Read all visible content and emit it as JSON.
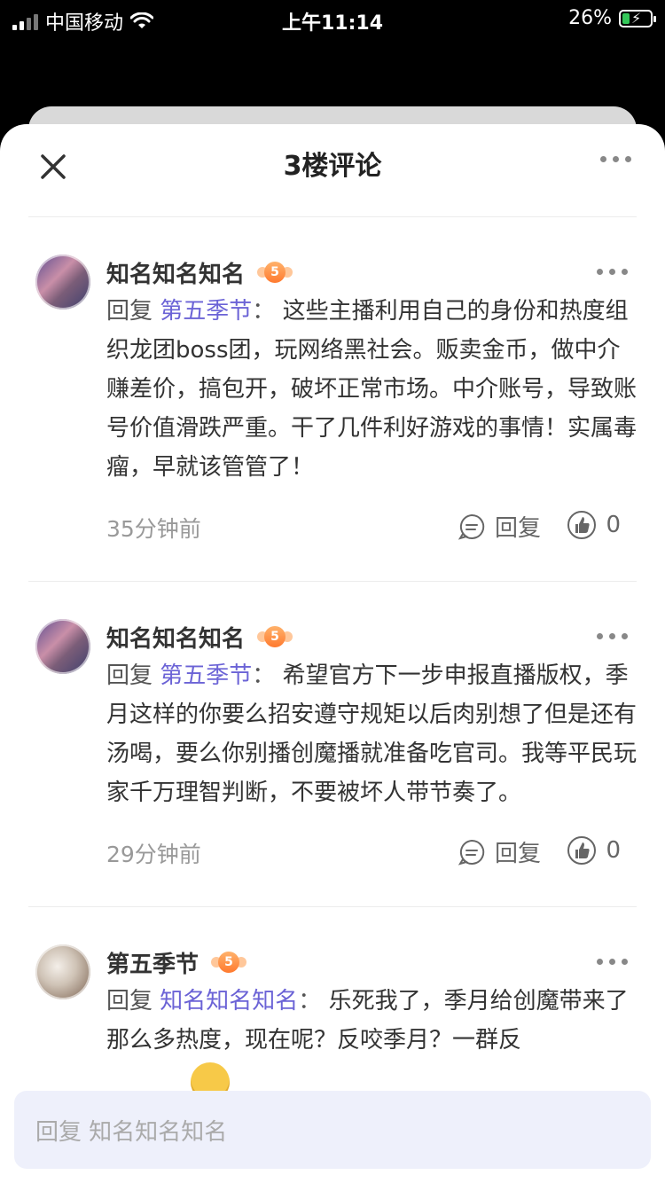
{
  "status_bar": {
    "carrier": "中国移动",
    "time": "上午11:14",
    "battery": "26%"
  },
  "sheet": {
    "title": "3楼评论"
  },
  "comments": [
    {
      "username": "知名知名知名",
      "level": "5",
      "reply_prefix": "回复",
      "mention": "第五季节",
      "separator": "：",
      "text": "这些主播利用自己的身份和热度组织龙团boss团，玩网络黑社会。贩卖金币，做中介赚差价，搞包开，破坏正常市场。中介账号，导致账号价值滑跌严重。干了几件利好游戏的事情！实属毒瘤，早就该管管了！",
      "time": "35分钟前",
      "reply_label": "回复",
      "likes": "0"
    },
    {
      "username": "知名知名知名",
      "level": "5",
      "reply_prefix": "回复",
      "mention": "第五季节",
      "separator": "：",
      "text": "希望官方下一步申报直播版权，季月这样的你要么招安遵守规矩以后肉别想了但是还有汤喝，要么你别播创魔播就准备吃官司。我等平民玩家千万理智判断，不要被坏人带节奏了。",
      "time": "29分钟前",
      "reply_label": "回复",
      "likes": "0"
    },
    {
      "username": "第五季节",
      "level": "5",
      "reply_prefix": "回复",
      "mention": "知名知名知名",
      "separator": "：",
      "text": "乐死我了，季月给创魔带来了那么多热度，现在呢？反咬季月？一群反"
    }
  ],
  "input": {
    "placeholder": "回复 知名知名知名"
  }
}
